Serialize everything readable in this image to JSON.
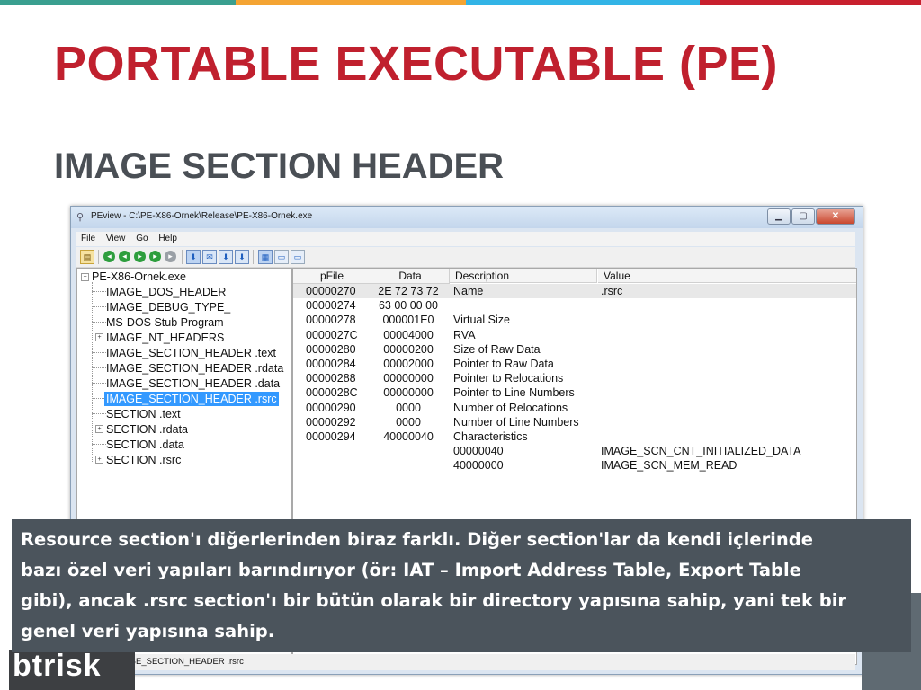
{
  "slide": {
    "title": "PORTABLE EXECUTABLE (PE)",
    "subtitle": "IMAGE SECTION HEADER",
    "accent_colors": [
      "#3a9f8f",
      "#f4a433",
      "#32b4e6",
      "#c8202e"
    ],
    "logo_text": "btrisk"
  },
  "window": {
    "title": "PEview - C:\\PE-X86-Ornek\\Release\\PE-X86-Ornek.exe",
    "menu": [
      "File",
      "View",
      "Go",
      "Help"
    ],
    "status": "Viewing IMAGE_SECTION_HEADER .rsrc"
  },
  "tree": [
    {
      "label": "PE-X86-Ornek.exe",
      "expander": "-"
    },
    {
      "label": "IMAGE_DOS_HEADER"
    },
    {
      "label": "IMAGE_DEBUG_TYPE_"
    },
    {
      "label": "MS-DOS Stub Program"
    },
    {
      "label": "IMAGE_NT_HEADERS",
      "expander": "+"
    },
    {
      "label": "IMAGE_SECTION_HEADER .text"
    },
    {
      "label": "IMAGE_SECTION_HEADER .rdata"
    },
    {
      "label": "IMAGE_SECTION_HEADER .data"
    },
    {
      "label": "IMAGE_SECTION_HEADER .rsrc",
      "selected": true
    },
    {
      "label": "SECTION .text"
    },
    {
      "label": "SECTION .rdata",
      "expander": "+"
    },
    {
      "label": "SECTION .data"
    },
    {
      "label": "SECTION .rsrc",
      "expander": "+"
    }
  ],
  "table": {
    "headers": [
      "pFile",
      "Data",
      "Description",
      "Value"
    ],
    "rows": [
      {
        "pfile": "00000270",
        "data": "2E  72  73  72",
        "desc": "Name",
        "value": ".rsrc"
      },
      {
        "pfile": "00000274",
        "data": "63  00  00  00",
        "desc": "",
        "value": ""
      },
      {
        "pfile": "00000278",
        "data": "000001E0",
        "desc": "Virtual Size",
        "value": ""
      },
      {
        "pfile": "0000027C",
        "data": "00004000",
        "desc": "RVA",
        "value": ""
      },
      {
        "pfile": "00000280",
        "data": "00000200",
        "desc": "Size of Raw Data",
        "value": ""
      },
      {
        "pfile": "00000284",
        "data": "00002000",
        "desc": "Pointer to Raw Data",
        "value": ""
      },
      {
        "pfile": "00000288",
        "data": "00000000",
        "desc": "Pointer to Relocations",
        "value": ""
      },
      {
        "pfile": "0000028C",
        "data": "00000000",
        "desc": "Pointer to Line Numbers",
        "value": ""
      },
      {
        "pfile": "00000290",
        "data": "0000",
        "desc": "Number of Relocations",
        "value": ""
      },
      {
        "pfile": "00000292",
        "data": "0000",
        "desc": "Number of Line Numbers",
        "value": ""
      },
      {
        "pfile": "00000294",
        "data": "40000040",
        "desc": "Characteristics",
        "value": ""
      },
      {
        "pfile": "",
        "data": "",
        "desc": "00000040",
        "value": "IMAGE_SCN_CNT_INITIALIZED_DATA"
      },
      {
        "pfile": "",
        "data": "",
        "desc": "40000000",
        "value": "IMAGE_SCN_MEM_READ"
      }
    ]
  },
  "caption": {
    "lines": [
      "Resource section'ı diğerlerinden biraz farklı. Diğer section'lar da kendi içlerinde",
      "bazı özel veri yapıları barındırıyor (ör: IAT – Import Address Table, Export Table",
      "gibi), ancak .rsrc section'ı bir bütün olarak bir directory yapısına sahip, yani tek bir",
      "genel veri yapısına sahip."
    ]
  }
}
